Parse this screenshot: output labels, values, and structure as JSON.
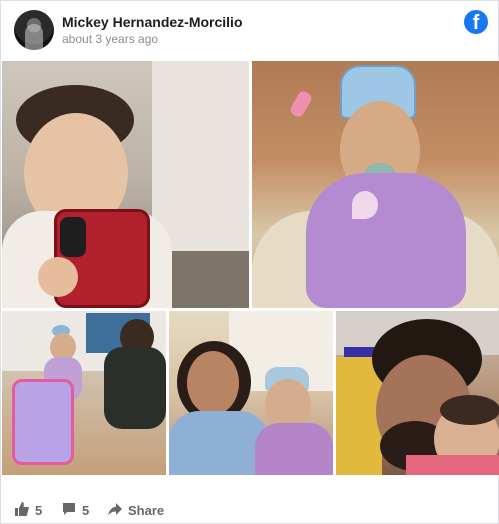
{
  "post": {
    "author": "Mickey Hernandez-Morcilio",
    "timestamp": "about 3 years ago",
    "brand_color": "#1877f2"
  },
  "photos": [
    {
      "name": "photo-baby-with-phone"
    },
    {
      "name": "photo-baby-with-crown"
    },
    {
      "name": "photo-baby-walker"
    },
    {
      "name": "photo-girl-holding-baby"
    },
    {
      "name": "photo-man-kissing-baby"
    }
  ],
  "actions": {
    "like_count": "5",
    "comment_count": "5",
    "share_label": "Share"
  },
  "icons": [
    "facebook-icon",
    "like-icon",
    "comment-icon",
    "share-icon"
  ]
}
